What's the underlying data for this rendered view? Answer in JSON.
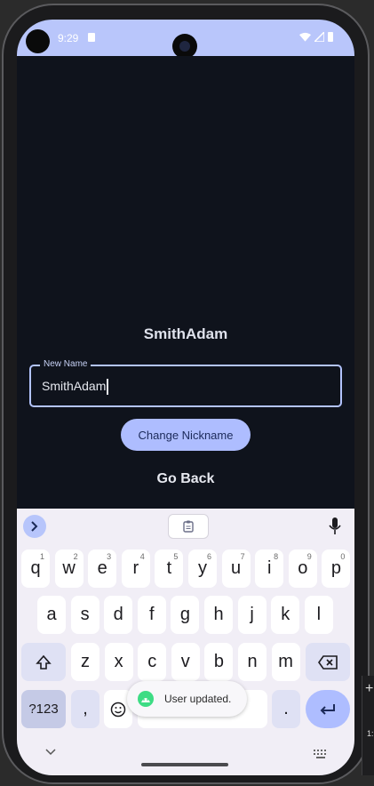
{
  "status_bar": {
    "time": "9:29"
  },
  "app": {
    "nickname": "SmithAdam",
    "field_label": "New Name",
    "field_value": "SmithAdam",
    "change_button": "Change Nickname",
    "go_back": "Go Back"
  },
  "keyboard": {
    "row1": [
      {
        "k": "q",
        "s": "1"
      },
      {
        "k": "w",
        "s": "2"
      },
      {
        "k": "e",
        "s": "3"
      },
      {
        "k": "r",
        "s": "4"
      },
      {
        "k": "t",
        "s": "5"
      },
      {
        "k": "y",
        "s": "6"
      },
      {
        "k": "u",
        "s": "7"
      },
      {
        "k": "i",
        "s": "8"
      },
      {
        "k": "o",
        "s": "9"
      },
      {
        "k": "p",
        "s": "0"
      }
    ],
    "row2": [
      "a",
      "s",
      "d",
      "f",
      "g",
      "h",
      "j",
      "k",
      "l"
    ],
    "row3": [
      "z",
      "x",
      "c",
      "v",
      "b",
      "n",
      "m"
    ],
    "symbols_label": "?123",
    "comma": ",",
    "period": "."
  },
  "toast": {
    "text": "User updated."
  },
  "side_panel": {
    "text": "1:"
  },
  "colors": {
    "accent": "#aebdff",
    "status_bar": "#b9c6fb",
    "app_bg": "#0f131c"
  }
}
